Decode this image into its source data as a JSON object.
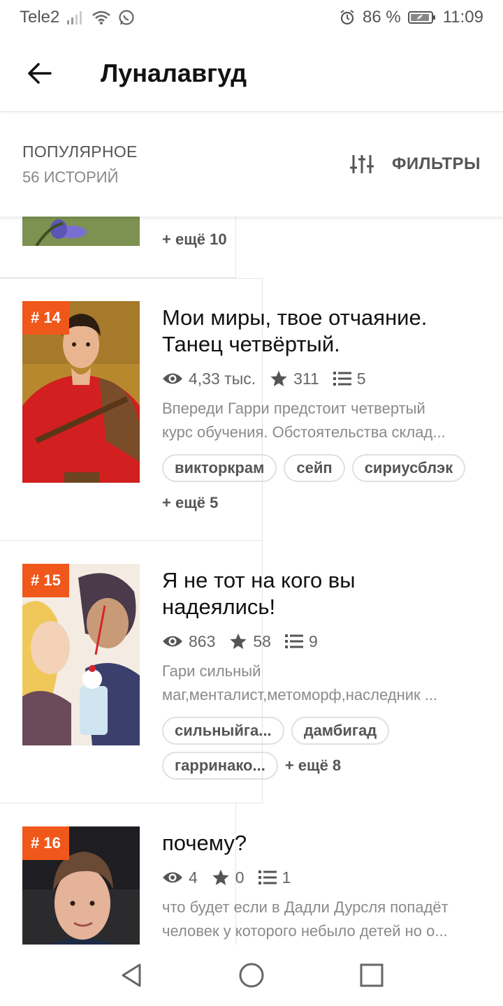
{
  "status_bar": {
    "carrier": "Tele2",
    "battery": "86 %",
    "time": "11:09"
  },
  "app_bar": {
    "title": "Луналавгуд"
  },
  "sort_header": {
    "title": "ПОПУЛЯРНОЕ",
    "count": "56 ИСТОРИЙ",
    "filters_label": "ФИЛЬТРЫ"
  },
  "partial_card": {
    "more": "+ ещё 10"
  },
  "stories": [
    {
      "rank": "# 14",
      "title_line1": "Мои миры, твое отчаяние.",
      "title_line2": "Танец четвёртый.",
      "views": "4,33 тыс.",
      "likes": "311",
      "chapters": "5",
      "desc_line1": "Впереди Гарри предстоит четвертый",
      "desc_line2": "курс обучения. Обстоятельства склад...",
      "tags": [
        "викторкрам",
        "сейп",
        "сириусблэк"
      ],
      "more": "+ ещё 5"
    },
    {
      "rank": "# 15",
      "title_line1": "Я не тот на кого вы",
      "title_line2": "надеялись!",
      "views": "863",
      "likes": "58",
      "chapters": "9",
      "desc_line1": "Гари сильный",
      "desc_line2": "маг,менталист,метоморф,наследник ...",
      "tags": [
        "сильныйга...",
        "дамбигад",
        "гарринако..."
      ],
      "more": "+ ещё 8"
    },
    {
      "rank": "# 16",
      "title_line1": "почему?",
      "title_line2": "",
      "views": "4",
      "likes": "0",
      "chapters": "1",
      "desc_line1": "что будет если в Дадли Дурсля попадёт",
      "desc_line2": "человек у которого небыло детей но о..."
    }
  ],
  "colors": {
    "accent": "#f0571b",
    "text_primary": "#111111",
    "text_secondary": "#666666"
  },
  "icons": {
    "back": "arrow-left-icon",
    "filters": "sliders-icon",
    "views": "eye-icon",
    "likes": "star-icon",
    "chapters": "list-icon",
    "nav_back": "triangle-back-icon",
    "nav_home": "circle-home-icon",
    "nav_recents": "square-recents-icon"
  }
}
